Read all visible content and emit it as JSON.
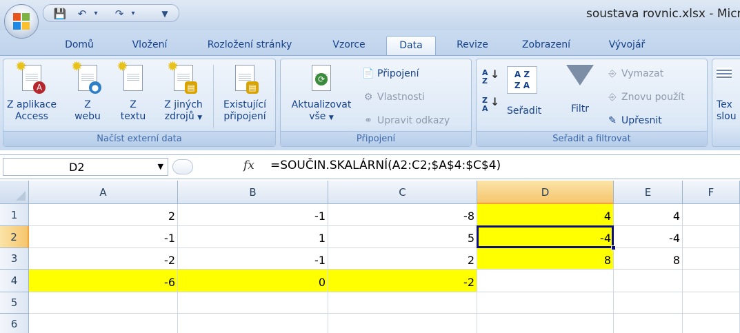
{
  "window": {
    "title": "soustava rovnic.xlsx - Micro"
  },
  "quick_access": {
    "icons": [
      "save-icon",
      "undo-icon",
      "redo-icon",
      "customize-icon"
    ]
  },
  "tabs": [
    {
      "label": "Domů",
      "active": false
    },
    {
      "label": "Vložení",
      "active": false
    },
    {
      "label": "Rozložení stránky",
      "active": false
    },
    {
      "label": "Vzorce",
      "active": false
    },
    {
      "label": "Data",
      "active": true
    },
    {
      "label": "Revize",
      "active": false
    },
    {
      "label": "Zobrazení",
      "active": false
    },
    {
      "label": "Vývojář",
      "active": false
    }
  ],
  "ribbon": {
    "external_data": {
      "label": "Načíst externí data",
      "access": {
        "line1": "Z aplikace",
        "line2": "Access"
      },
      "web": {
        "line1": "Z",
        "line2": "webu"
      },
      "text": {
        "line1": "Z",
        "line2": "textu"
      },
      "other": {
        "line1": "Z jiných",
        "line2": "zdrojů"
      },
      "existing": {
        "line1": "Existující",
        "line2": "připojení"
      }
    },
    "connections": {
      "label": "Připojení",
      "refresh": {
        "line1": "Aktualizovat",
        "line2": "vše"
      },
      "connections": "Připojení",
      "properties": "Vlastnosti",
      "edit_links": "Upravit odkazy"
    },
    "sort_filter": {
      "label": "Seřadit a filtrovat",
      "sort": "Seřadit",
      "filter": "Filtr",
      "clear": "Vymazat",
      "reapply": "Znovu použít",
      "advanced": "Upřesnit",
      "az": "A\nZ",
      "sort_grid": "A Z\nZ A"
    },
    "next_group": {
      "line1": "Tex",
      "line2": "slou"
    }
  },
  "formula_bar": {
    "name_box": "D2",
    "fx": "fx",
    "formula": "=SOUČIN.SKALÁRNÍ(A2:C2;$A$4:$C$4)"
  },
  "sheet": {
    "columns": [
      "A",
      "B",
      "C",
      "D",
      "E",
      "F"
    ],
    "selected_column": "D",
    "rows": [
      "1",
      "2",
      "3",
      "4",
      "5",
      "6"
    ],
    "selected_row": "2",
    "cells": [
      [
        "2",
        "-1",
        "-8",
        "4",
        "4",
        ""
      ],
      [
        "-1",
        "1",
        "5",
        "-4",
        "-4",
        ""
      ],
      [
        "-2",
        "-1",
        "2",
        "8",
        "8",
        ""
      ],
      [
        "-6",
        "0",
        "-2",
        "",
        "",
        ""
      ],
      [
        "",
        "",
        "",
        "",
        "",
        ""
      ],
      [
        "",
        "",
        "",
        "",
        "",
        ""
      ]
    ],
    "highlight_color": "#ffff00",
    "active_cell": "D2"
  }
}
